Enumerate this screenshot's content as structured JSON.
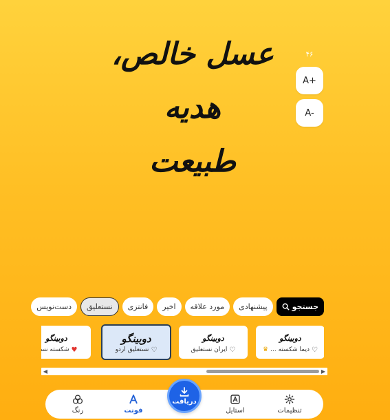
{
  "canvas": {
    "line1": "عسل خالص، هدیه",
    "line2": "طبیعت"
  },
  "font_size": {
    "value": "۴۶",
    "increase_label": "A+",
    "decrease_label": "A-"
  },
  "chips": [
    {
      "label": "جستجو",
      "icon": "search-icon",
      "kind": "search"
    },
    {
      "label": "پیشنهادی"
    },
    {
      "label": "مورد علاقه"
    },
    {
      "label": "اخیر"
    },
    {
      "label": "فانتزی"
    },
    {
      "label": "نستعلیق",
      "active": true
    },
    {
      "label": "دست‌نویس"
    }
  ],
  "cards": [
    {
      "preview": "دوبینگو",
      "name": "دیما شکسته ...",
      "badge": "crown-icon",
      "favorite": false
    },
    {
      "preview": "دوبینگو",
      "name": "ایران نستعلیق",
      "favorite": false
    },
    {
      "preview": "دوبینگو",
      "name": "نستعلیق اردو",
      "favorite": false,
      "selected": true
    },
    {
      "preview": "دوبینگو",
      "name": "شکسته نستع",
      "favorite": true
    }
  ],
  "nav": {
    "settings": "تنظیمات",
    "style": "استایل",
    "download": "دریافت",
    "font": "فونت",
    "color": "رنگ"
  },
  "colors": {
    "accent": "#1e63e6",
    "background_top": "#ffd23c",
    "background_bottom": "#ffae10"
  }
}
